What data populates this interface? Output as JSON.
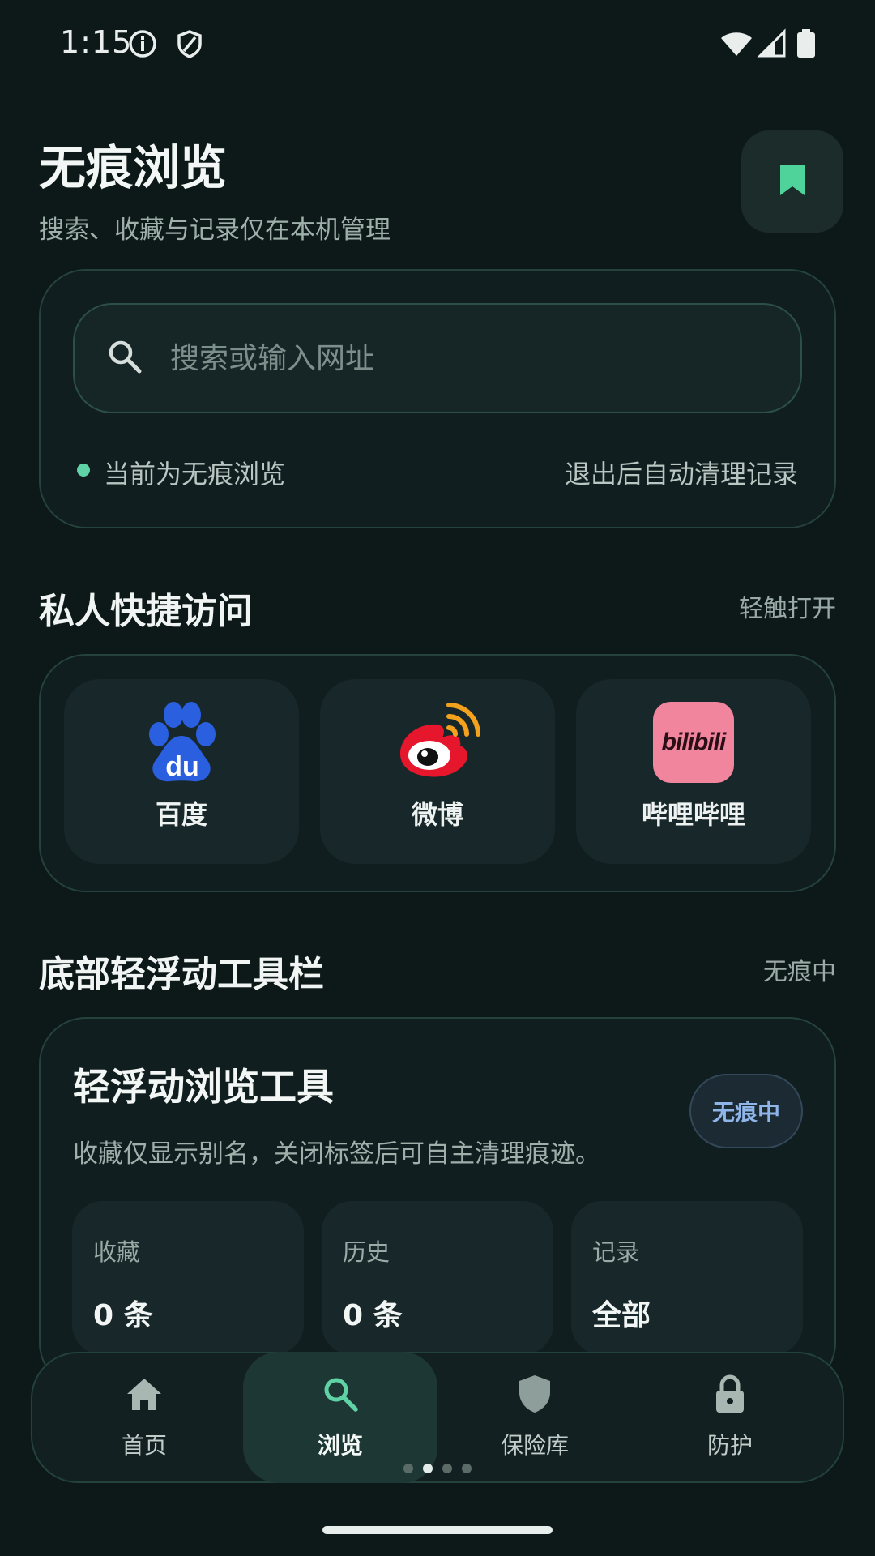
{
  "status_bar": {
    "time": "1:15"
  },
  "header": {
    "title": "无痕浏览",
    "subtitle": "搜索、收藏与记录仅在本机管理"
  },
  "search": {
    "placeholder": "搜索或输入网址",
    "mode_label": "当前为无痕浏览",
    "mode_note": "退出后自动清理记录"
  },
  "quick_access": {
    "title": "私人快捷访问",
    "hint": "轻触打开",
    "items": [
      {
        "label": "百度",
        "icon": "baidu-paw-logo"
      },
      {
        "label": "微博",
        "icon": "weibo-eye-logo"
      },
      {
        "label": "哔哩哔哩",
        "icon": "bilibili-logo",
        "logo_text": "bilibili"
      }
    ]
  },
  "toolbar_section": {
    "title": "底部轻浮动工具栏",
    "hint": "无痕中",
    "card_title": "轻浮动浏览工具",
    "card_desc": "收藏仅显示别名，关闭标签后可自主清理痕迹。",
    "badge": "无痕中",
    "stats": [
      {
        "label": "收藏",
        "value": "0 条"
      },
      {
        "label": "历史",
        "value": "0 条"
      },
      {
        "label": "记录",
        "value": "全部"
      }
    ]
  },
  "bottom_nav": {
    "items": [
      {
        "label": "首页",
        "icon": "home-icon"
      },
      {
        "label": "浏览",
        "icon": "search-icon"
      },
      {
        "label": "保险库",
        "icon": "shield-icon"
      },
      {
        "label": "防护",
        "icon": "lock-icon"
      }
    ],
    "active_index": 1,
    "page_dots": 4,
    "active_dot": 1
  },
  "colors": {
    "background": "#0d1819",
    "accent": "#5fd3a6",
    "bookmark": "#4fd39a",
    "badge_text": "#8fb4e8"
  }
}
